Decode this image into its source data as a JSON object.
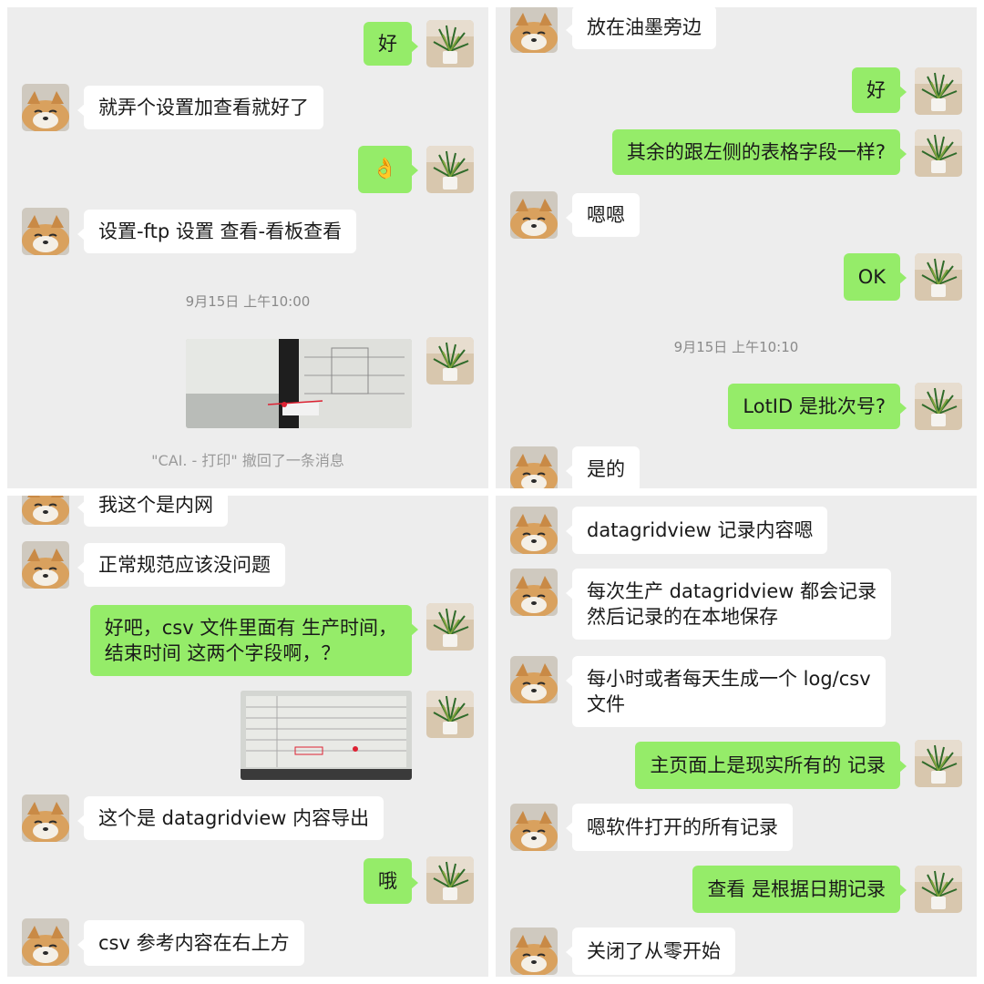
{
  "panel_top_left": {
    "messages": [
      {
        "side": "out",
        "text": "好"
      },
      {
        "side": "in",
        "text": "就弄个设置加查看就好了"
      },
      {
        "side": "out",
        "text": "👌"
      },
      {
        "side": "in",
        "text": "设置-ftp 设置 查看-看板查看"
      }
    ],
    "timestamp": "9月15日 上午10:00",
    "recall_notice": "\"CAI. - 打印\" 撤回了一条消息"
  },
  "panel_top_right": {
    "messages": [
      {
        "side": "in",
        "text": "放在油墨旁边"
      },
      {
        "side": "out",
        "text": "好"
      },
      {
        "side": "out",
        "text": "其余的跟左侧的表格字段一样?"
      },
      {
        "side": "in",
        "text": "嗯嗯"
      },
      {
        "side": "out",
        "text": "OK"
      }
    ],
    "timestamp": "9月15日 上午10:10",
    "messages_after": [
      {
        "side": "out",
        "text": "LotID 是批次号?"
      },
      {
        "side": "in",
        "text": "是的"
      }
    ]
  },
  "panel_bottom_left": {
    "messages": [
      {
        "side": "in",
        "text": "我这个是内网"
      },
      {
        "side": "in",
        "text": "正常规范应该没问题"
      },
      {
        "side": "out",
        "lines": [
          "好吧，csv 文件里面有 生产时间，",
          "结束时间 这两个字段啊，？"
        ]
      },
      {
        "side": "in",
        "text": "这个是 datagridview 内容导出"
      },
      {
        "side": "out",
        "text": "哦"
      },
      {
        "side": "in",
        "text": "csv 参考内容在右上方"
      }
    ]
  },
  "panel_bottom_right": {
    "messages": [
      {
        "side": "in",
        "text": "datagridview 记录内容嗯"
      },
      {
        "side": "in",
        "lines": [
          "每次生产 datagridview 都会记录",
          "然后记录的在本地保存"
        ]
      },
      {
        "side": "in",
        "lines": [
          "每小时或者每天生成一个 log/csv",
          "文件"
        ]
      },
      {
        "side": "out",
        "text": "主页面上是现实所有的 记录"
      },
      {
        "side": "in",
        "text": "嗯软件打开的所有记录"
      },
      {
        "side": "out",
        "text": "查看 是根据日期记录"
      },
      {
        "side": "in",
        "text": "关闭了从零开始"
      }
    ]
  },
  "colors": {
    "bg": "#ededed",
    "bubble_out": "#95ec69",
    "bubble_in": "#ffffff",
    "timestamp": "#8a8a8a"
  }
}
